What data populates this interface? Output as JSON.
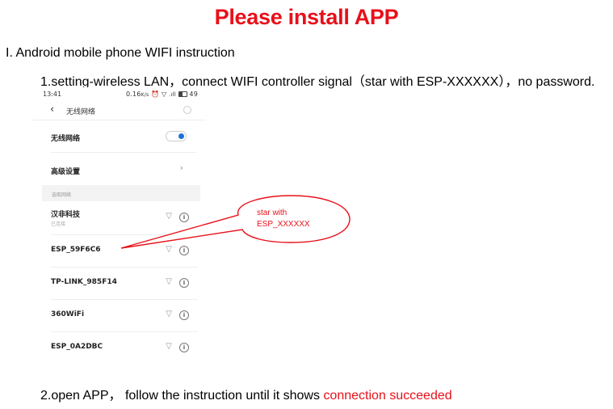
{
  "title": "Please install APP",
  "section_heading": "I. Android mobile phone WIFI instruction",
  "step1": "1.setting-wireless LAN，connect WIFI controller signal（star with ESP-XXXXXX），no password.",
  "step2": {
    "prefix": "2.open APP， follow the instruction until it shows ",
    "highlight": "connection succeeded"
  },
  "phone": {
    "status_bar": {
      "time": "13:41",
      "indicators": "0.16ᴷ/s ⏰ ▽ .ıl ▭ 49"
    },
    "nav": {
      "back_icon": "chevron-left",
      "title": "无线网络"
    },
    "wifi_toggle": {
      "label": "无线网络",
      "on": true
    },
    "advanced_settings": {
      "label": "高级设置",
      "chevron": "›"
    },
    "section_header": "选取网络",
    "networks": [
      {
        "name": "汉非科技",
        "status": "已连接",
        "wifi_icon": "wifi-locked-icon",
        "info": "i"
      },
      {
        "name": "ESP_59F6C6",
        "status": "",
        "wifi_icon": "wifi-icon",
        "info": "i"
      },
      {
        "name": "TP-LINK_985F14",
        "status": "",
        "wifi_icon": "wifi-icon",
        "info": "i"
      },
      {
        "name": "360WiFi",
        "status": "",
        "wifi_icon": "wifi-locked-icon",
        "info": "i"
      },
      {
        "name": "ESP_0A2DBC",
        "status": "",
        "wifi_icon": "wifi-icon",
        "info": "i"
      }
    ]
  },
  "callout": {
    "line1": "star with",
    "line2": "ESP_XXXXXX",
    "color": "#e8101a"
  },
  "colors": {
    "accent_red": "#e8101a",
    "toggle_blue": "#1e6fd9"
  }
}
